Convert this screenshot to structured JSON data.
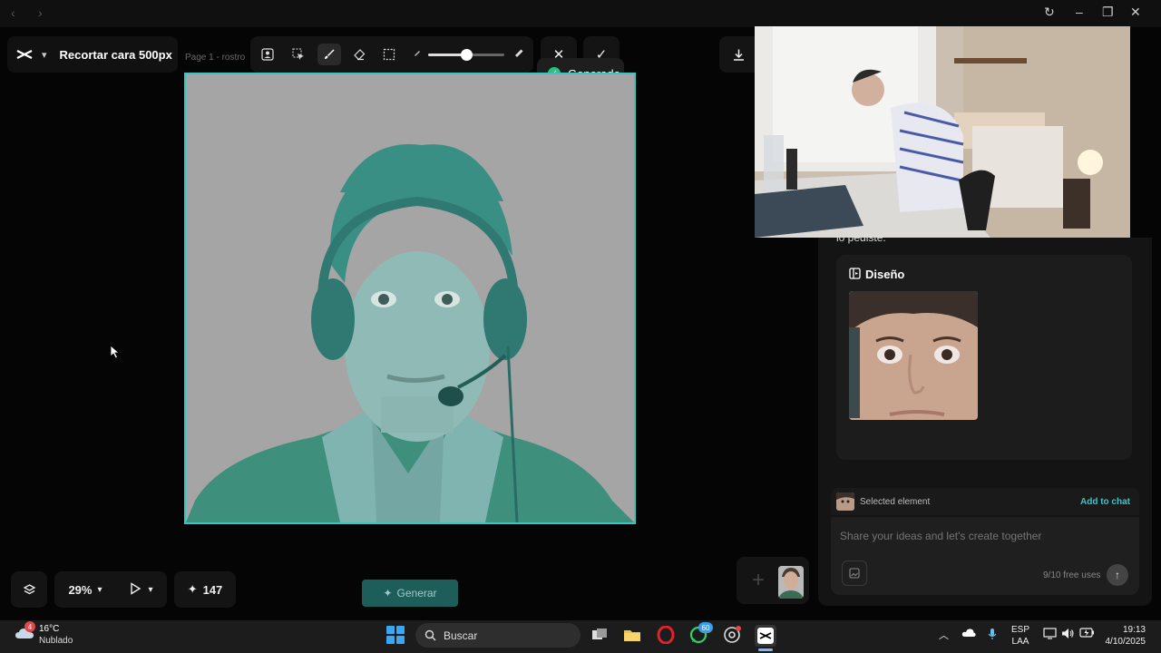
{
  "project": {
    "title": "Recortar cara 500px",
    "page_label": "Page 1 -  rostro"
  },
  "toast": {
    "text": "Generado"
  },
  "zoom": {
    "value": "29%"
  },
  "credits": {
    "value": "147"
  },
  "generate_button": {
    "label": "Generar"
  },
  "toolbar": {
    "brush_size_fraction": 0.5
  },
  "panel": {
    "partial_text": "lo pediste.",
    "design_title": "Diseño",
    "selected_label": "Selected element",
    "add_to_chat": "Add to chat",
    "chat_placeholder": "Share your ideas and let's create together",
    "free_uses": "9/10 free uses"
  },
  "taskbar": {
    "weather_badge": "4",
    "temperature": "16°C",
    "condition": "Nublado",
    "search": "Buscar",
    "whatsapp_badge": "60",
    "lang_line1": "ESP",
    "lang_line2": "LAA",
    "time": "19:13",
    "date": "4/10/2025"
  },
  "colors": {
    "accent": "#36c7c0",
    "toast_check": "#27c27a",
    "add_to_chat": "#2fc9d0",
    "generate_bg": "#1e5e5a"
  }
}
